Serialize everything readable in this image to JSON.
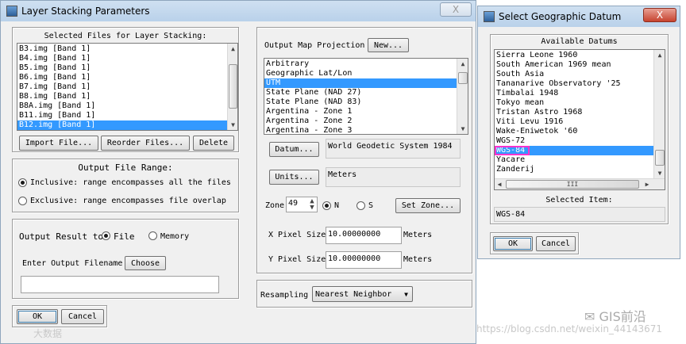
{
  "layer_window": {
    "title": "Layer Stacking Parameters",
    "selected_files": {
      "label": "Selected Files for Layer Stacking:",
      "items": [
        "B3.img [Band 1]",
        "B4.img [Band 1]",
        "B5.img [Band 1]",
        "B6.img [Band 1]",
        "B7.img [Band 1]",
        "B8.img [Band 1]",
        "B8A.img [Band 1]",
        "B11.img [Band 1]",
        "B12.img [Band 1]"
      ],
      "selected_index": 8
    },
    "buttons": {
      "import": "Import File...",
      "reorder": "Reorder Files...",
      "delete": "Delete",
      "ok": "OK",
      "cancel": "Cancel",
      "choose": "Choose"
    },
    "output_range": {
      "label": "Output File Range:",
      "inclusive": "Inclusive: range encompasses all the files",
      "exclusive": "Exclusive: range encompasses file overlap",
      "selected": "inclusive"
    },
    "output_result": {
      "label": "Output Result to",
      "file": "File",
      "memory": "Memory",
      "selected": "file"
    },
    "filename": {
      "label": "Enter Output Filename",
      "value": ""
    },
    "projection": {
      "label": "Output Map Projection",
      "new_button": "New...",
      "items": [
        "Arbitrary",
        "Geographic Lat/Lon",
        "UTM",
        "State Plane (NAD 27)",
        "State Plane (NAD 83)",
        "Argentina - Zone 1",
        "Argentina - Zone 2",
        "Argentina - Zone 3"
      ],
      "selected_index": 2
    },
    "datum": {
      "button": "Datum...",
      "value": "World Geodetic System 1984"
    },
    "units": {
      "button": "Units...",
      "value": "Meters"
    },
    "zone": {
      "label": "Zone",
      "value": "49",
      "north": "N",
      "south": "S",
      "hemisphere": "N",
      "set_button": "Set Zone..."
    },
    "x_pixel": {
      "label": "X Pixel Size",
      "value": "10.00000000",
      "unit": "Meters"
    },
    "y_pixel": {
      "label": "Y Pixel Size",
      "value": "10.00000000",
      "unit": "Meters"
    },
    "resampling": {
      "label": "Resampling",
      "value": "Nearest Neighbor"
    }
  },
  "datum_window": {
    "title": "Select Geographic Datum",
    "available_label": "Available Datums",
    "items": [
      "Sierra Leone 1960",
      "South American 1969 mean",
      "South Asia",
      "Tananarive Observatory '25",
      "Timbalai 1948",
      "Tokyo mean",
      "Tristan Astro 1968",
      "Viti Levu 1916",
      "Wake-Eniwetok '60",
      "WGS-72",
      "WGS-84",
      "Yacare",
      "Zanderij"
    ],
    "selected_index": 10,
    "hscroll_grip": "III",
    "selected_item_label": "Selected Item:",
    "selected_item_value": "WGS-84",
    "buttons": {
      "ok": "OK",
      "cancel": "Cancel"
    }
  },
  "window_controls": {
    "minimize": "—",
    "close": "X"
  },
  "watermarks": {
    "right": "GIS前沿",
    "url": "https://blog.csdn.net/weixin_44143671",
    "left": "大数据"
  },
  "colors": {
    "selection": "#3399ff",
    "highlight_box": "#ff33cc",
    "title_bar": "#bfd5ec"
  }
}
